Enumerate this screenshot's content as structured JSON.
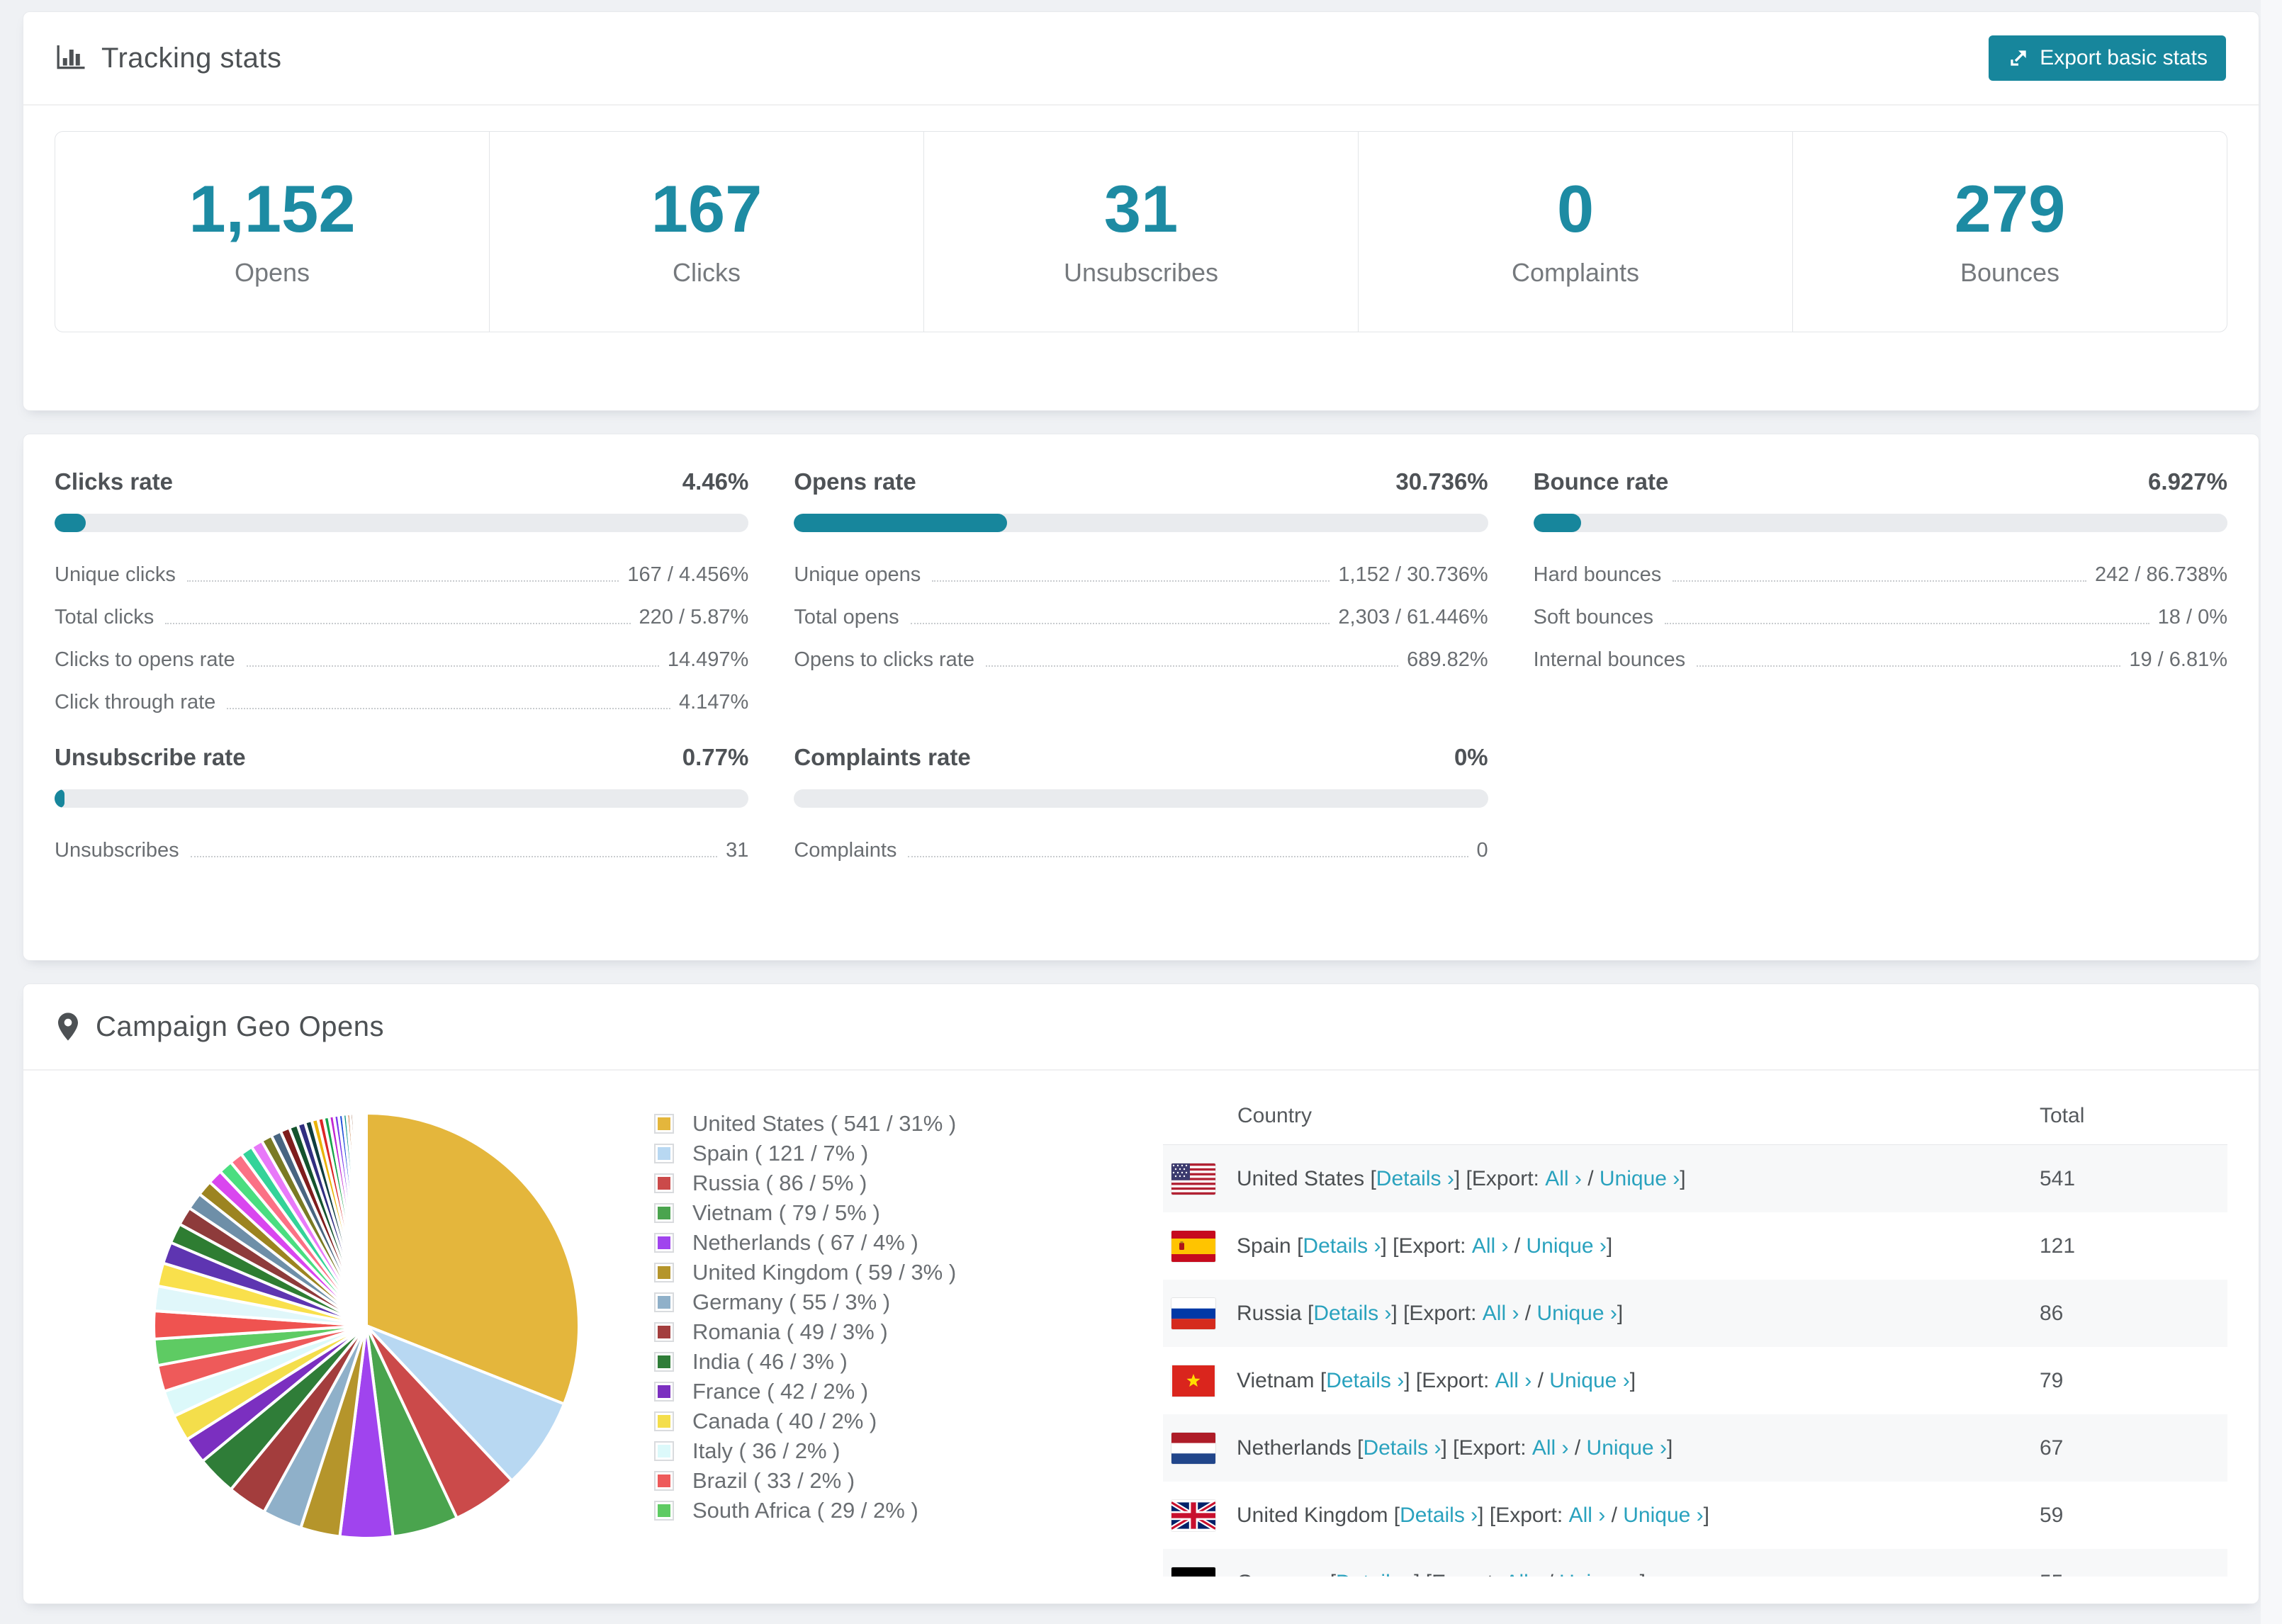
{
  "tracking": {
    "title": "Tracking stats",
    "export_button": "Export basic stats",
    "summary": [
      {
        "value": "1,152",
        "label": "Opens"
      },
      {
        "value": "167",
        "label": "Clicks"
      },
      {
        "value": "31",
        "label": "Unsubscribes"
      },
      {
        "value": "0",
        "label": "Complaints"
      },
      {
        "value": "279",
        "label": "Bounces"
      }
    ]
  },
  "rates": {
    "sections": [
      {
        "title": "Clicks rate",
        "value": "4.46%",
        "bar_pct": 4.46,
        "rows": [
          {
            "label": "Unique clicks",
            "value": "167 / 4.456%"
          },
          {
            "label": "Total clicks",
            "value": "220 / 5.87%"
          },
          {
            "label": "Clicks to opens rate",
            "value": "14.497%"
          },
          {
            "label": "Click through rate",
            "value": "4.147%"
          }
        ]
      },
      {
        "title": "Opens rate",
        "value": "30.736%",
        "bar_pct": 30.736,
        "rows": [
          {
            "label": "Unique opens",
            "value": "1,152 / 30.736%"
          },
          {
            "label": "Total opens",
            "value": "2,303 / 61.446%"
          },
          {
            "label": "Opens to clicks rate",
            "value": "689.82%"
          }
        ]
      },
      {
        "title": "Bounce rate",
        "value": "6.927%",
        "bar_pct": 6.927,
        "rows": [
          {
            "label": "Hard bounces",
            "value": "242 / 86.738%"
          },
          {
            "label": "Soft bounces",
            "value": "18 / 0%"
          },
          {
            "label": "Internal bounces",
            "value": "19 / 6.81%"
          }
        ]
      },
      {
        "title": "Unsubscribe rate",
        "value": "0.77%",
        "bar_pct": 0.77,
        "rows": [
          {
            "label": "Unsubscribes",
            "value": "31"
          }
        ]
      },
      {
        "title": "Complaints rate",
        "value": "0%",
        "bar_pct": 0,
        "rows": [
          {
            "label": "Complaints",
            "value": "0"
          }
        ]
      }
    ]
  },
  "geo": {
    "title": "Campaign Geo Opens",
    "table": {
      "col_country": "Country",
      "col_total": "Total",
      "open_bracket": "[",
      "close_bracket": "]",
      "details_label": "Details ›",
      "export_label": "Export:",
      "all_label": "All ›",
      "slash": "/",
      "unique_label": "Unique ›",
      "visible_rows": 7
    },
    "countries": [
      {
        "name": "United States",
        "total": 541,
        "pct": 31,
        "color": "#e4b63c",
        "flag": "us"
      },
      {
        "name": "Spain",
        "total": 121,
        "pct": 7,
        "color": "#b8d8f2",
        "flag": "es"
      },
      {
        "name": "Russia",
        "total": 86,
        "pct": 5,
        "color": "#cb4a4a",
        "flag": "ru"
      },
      {
        "name": "Vietnam",
        "total": 79,
        "pct": 5,
        "color": "#4aa44e",
        "flag": "vn"
      },
      {
        "name": "Netherlands",
        "total": 67,
        "pct": 4,
        "color": "#a044ee",
        "flag": "nl"
      },
      {
        "name": "United Kingdom",
        "total": 59,
        "pct": 3,
        "color": "#b5952b",
        "flag": "gb"
      },
      {
        "name": "Germany",
        "total": 55,
        "pct": 3,
        "color": "#8fb0c9",
        "flag": "de"
      },
      {
        "name": "Romania",
        "total": 49,
        "pct": 3,
        "color": "#a33d3d"
      },
      {
        "name": "India",
        "total": 46,
        "pct": 3,
        "color": "#2f7d38"
      },
      {
        "name": "France",
        "total": 42,
        "pct": 2,
        "color": "#7b2fc0"
      },
      {
        "name": "Canada",
        "total": 40,
        "pct": 2,
        "color": "#f4de4b"
      },
      {
        "name": "Italy",
        "total": 36,
        "pct": 2,
        "color": "#dcf9fa"
      },
      {
        "name": "Brazil",
        "total": 33,
        "pct": 2,
        "color": "#ee5a5a"
      },
      {
        "name": "South Africa",
        "total": 29,
        "pct": 2,
        "color": "#5ecb63"
      }
    ],
    "pie_others": {
      "weights": [
        1.8,
        1.6,
        1.5,
        1.4,
        1.3,
        1.2,
        1.1,
        1.0,
        0.95,
        0.9,
        0.85,
        0.8,
        0.75,
        0.7,
        0.65,
        0.6,
        0.55,
        0.5,
        0.45,
        0.4,
        0.38,
        0.35,
        0.32,
        0.3,
        0.28,
        0.25,
        0.22,
        0.2,
        0.18,
        0.15,
        0.12,
        0.1,
        0.08,
        0.06,
        0.05,
        0.04,
        0.03,
        0.02
      ],
      "colors": [
        "#ef5350",
        "#e0f7fa",
        "#f9e04c",
        "#5e35b1",
        "#2e7d32",
        "#8e3b3b",
        "#6e8fa8",
        "#9c8420",
        "#d946ef",
        "#4ade80",
        "#fb7185",
        "#34d399",
        "#e879f9",
        "#7a7a24",
        "#486581",
        "#7f1d1d",
        "#14532d",
        "#312e81",
        "#0f3d3e",
        "#eab308",
        "#dc2626",
        "#16a34a",
        "#c026d3",
        "#7c3aed",
        "#1d4ed8",
        "#0d9488",
        "#b45309",
        "#78350f",
        "#a3e635",
        "#06b6d4",
        "#6d28d9",
        "#facc15",
        "#f87171",
        "#22c55e",
        "#d8b4fe",
        "#94a3b8",
        "#fca5a5",
        "#86efac"
      ]
    }
  },
  "chart_data": {
    "type": "pie",
    "title": "Campaign Geo Opens",
    "unit": "opens",
    "labels": [
      "United States",
      "Spain",
      "Russia",
      "Vietnam",
      "Netherlands",
      "United Kingdom",
      "Germany",
      "Romania",
      "India",
      "France",
      "Canada",
      "Italy",
      "Brazil",
      "South Africa"
    ],
    "values": [
      541,
      121,
      86,
      79,
      67,
      59,
      55,
      49,
      46,
      42,
      40,
      36,
      33,
      29
    ],
    "pcts": [
      31,
      7,
      5,
      5,
      4,
      3,
      3,
      3,
      3,
      2,
      2,
      2,
      2,
      2
    ],
    "others_pct": 26,
    "legend_position": "right",
    "start_angle_deg": -90,
    "direction": "clockwise"
  }
}
